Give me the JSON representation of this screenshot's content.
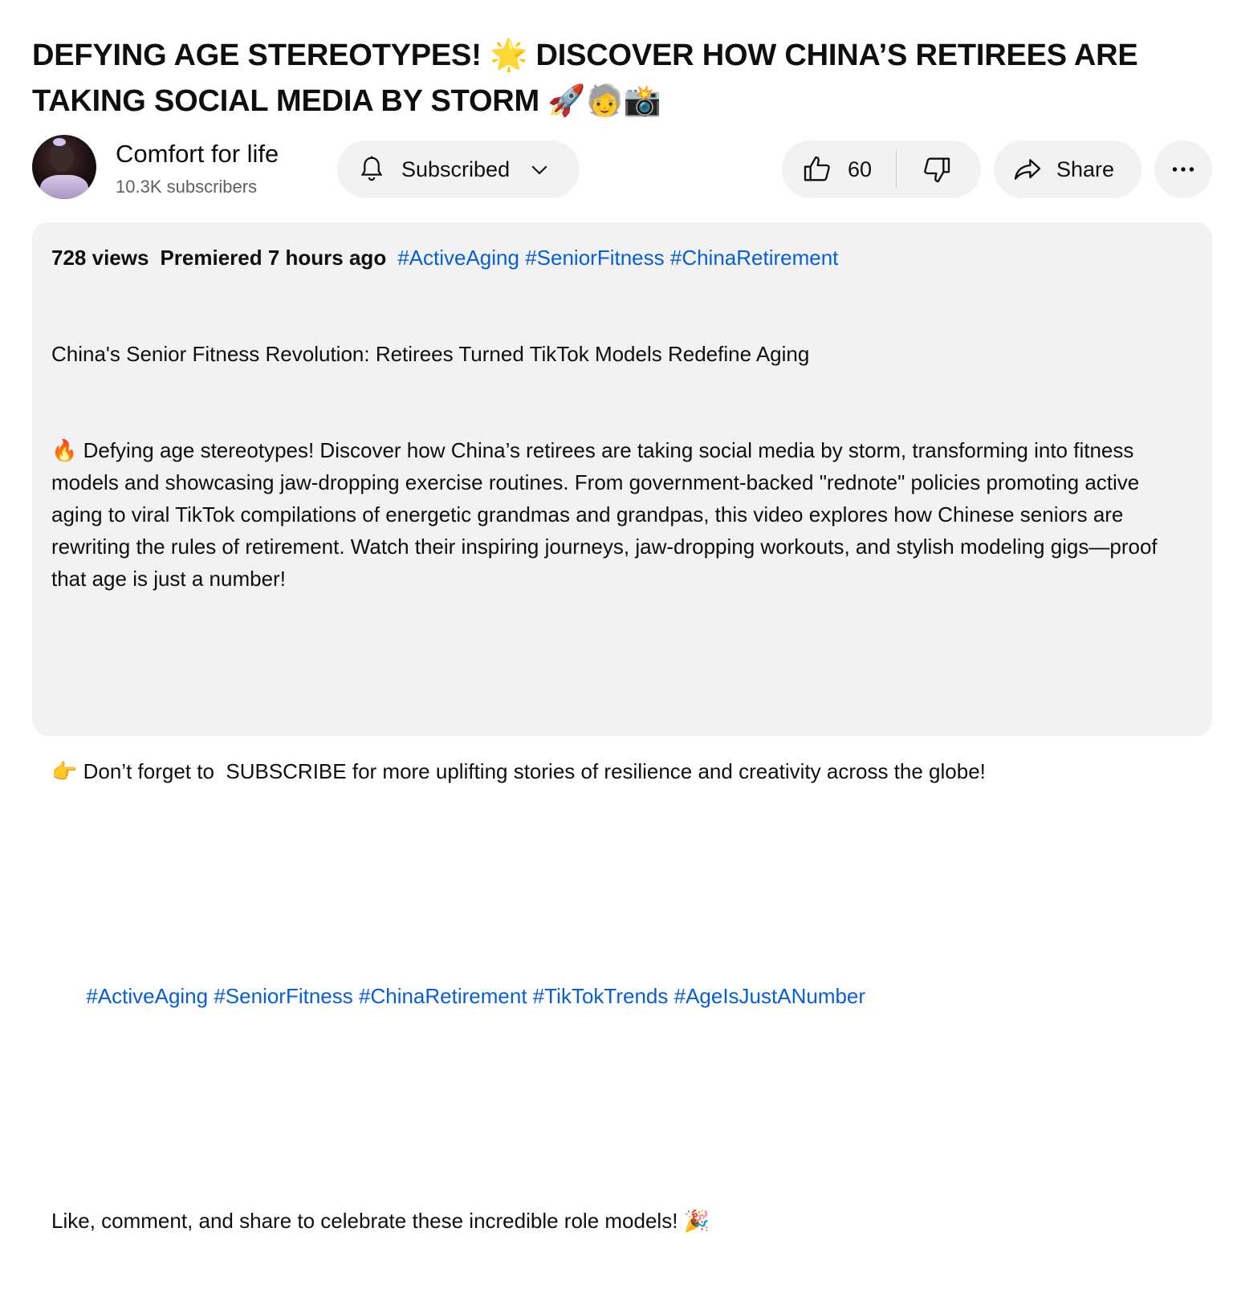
{
  "video": {
    "title_text": "DEFYING AGE STEREOTYPES! ",
    "title_emoji_1": "🌟",
    "title_text_2": " DISCOVER HOW CHINA’S RETIREES ARE TAKING SOCIAL MEDIA BY STORM ",
    "title_emoji_2": "🚀🧓📸"
  },
  "channel": {
    "name": "Comfort for life",
    "subscribers": "10.3K subscribers"
  },
  "actions": {
    "subscribe_label": "Subscribed",
    "like_count": "60",
    "share_label": "Share"
  },
  "description": {
    "views": "728 views",
    "premiered": "Premiered 7 hours ago",
    "meta_tags": [
      "#ActiveAging",
      "#SeniorFitness",
      "#ChinaRetirement"
    ],
    "headline": "China's Senior Fitness Revolution: Retirees Turned TikTok Models Redefine Aging",
    "fire_emoji": "🔥",
    "para1": " Defying age stereotypes! Discover how China’s retirees are taking social media by storm, transforming into fitness models and showcasing jaw-dropping exercise routines. From government-backed \"rednote\" policies promoting active aging to viral TikTok compilations of energetic grandmas and grandpas, this video explores how Chinese seniors are rewriting the rules of retirement. Watch their inspiring journeys, jaw-dropping workouts, and stylish modeling gigs—proof that age is just a number!",
    "point_emoji": "👉",
    "para2": " Don’t forget to  SUBSCRIBE for more uplifting stories of resilience and creativity across the globe!",
    "hashtags": [
      "#ActiveAging",
      "#SeniorFitness",
      "#ChinaRetirement",
      "#TikTokTrends",
      "#AgeIsJustANumber"
    ],
    "para3": "Like, comment, and share to celebrate these incredible role models! ",
    "party_emoji": "🎉"
  },
  "icons": {
    "bell": "bell-icon",
    "chevron": "chevron-down-icon",
    "like": "thumbs-up-icon",
    "dislike": "thumbs-down-icon",
    "share": "share-arrow-icon",
    "more": "more-dots-icon"
  },
  "colors": {
    "link": "#065fd4",
    "pill_bg": "#f2f2f2",
    "secondary_text": "#606060"
  }
}
